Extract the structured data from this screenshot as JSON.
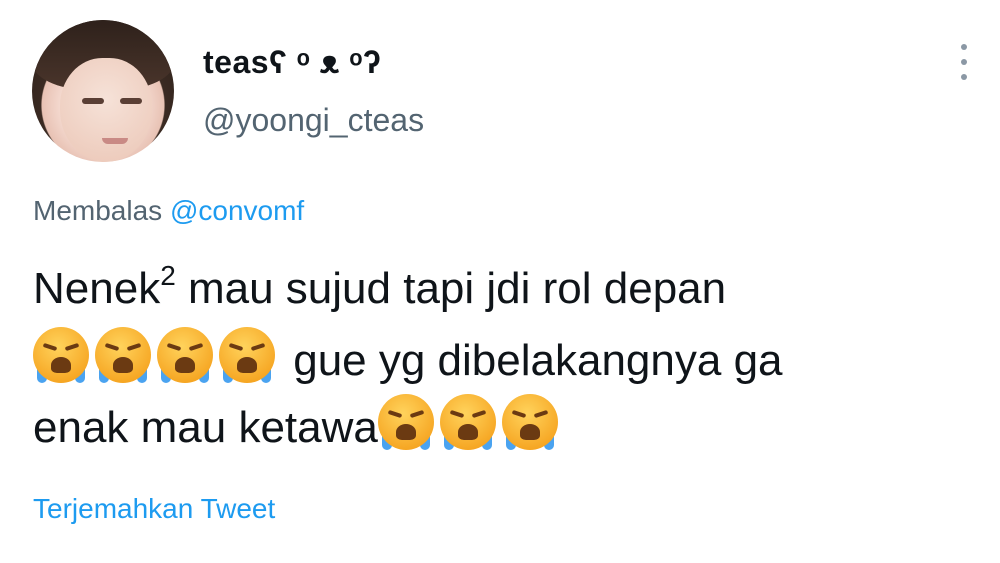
{
  "tweet": {
    "display_name": "teasʕ ᵒ ᴥ ᵒʔ",
    "handle": "@yoongi_cteas",
    "reply_prefix": "Membalas",
    "reply_mention": "@convomf",
    "text_part1": "Nenek",
    "text_sup": "2",
    "text_part2": " mau sujud tapi jdi rol depan",
    "text_part3": " gue yg dibelakangnya ga",
    "text_part4": "enak mau ketawa",
    "emoji_name": "loudly-crying-face-icon",
    "translate_label": "Terjemahkan Tweet"
  },
  "colors": {
    "link": "#1d9bf0",
    "secondary": "#536471",
    "text": "#0f1419"
  }
}
